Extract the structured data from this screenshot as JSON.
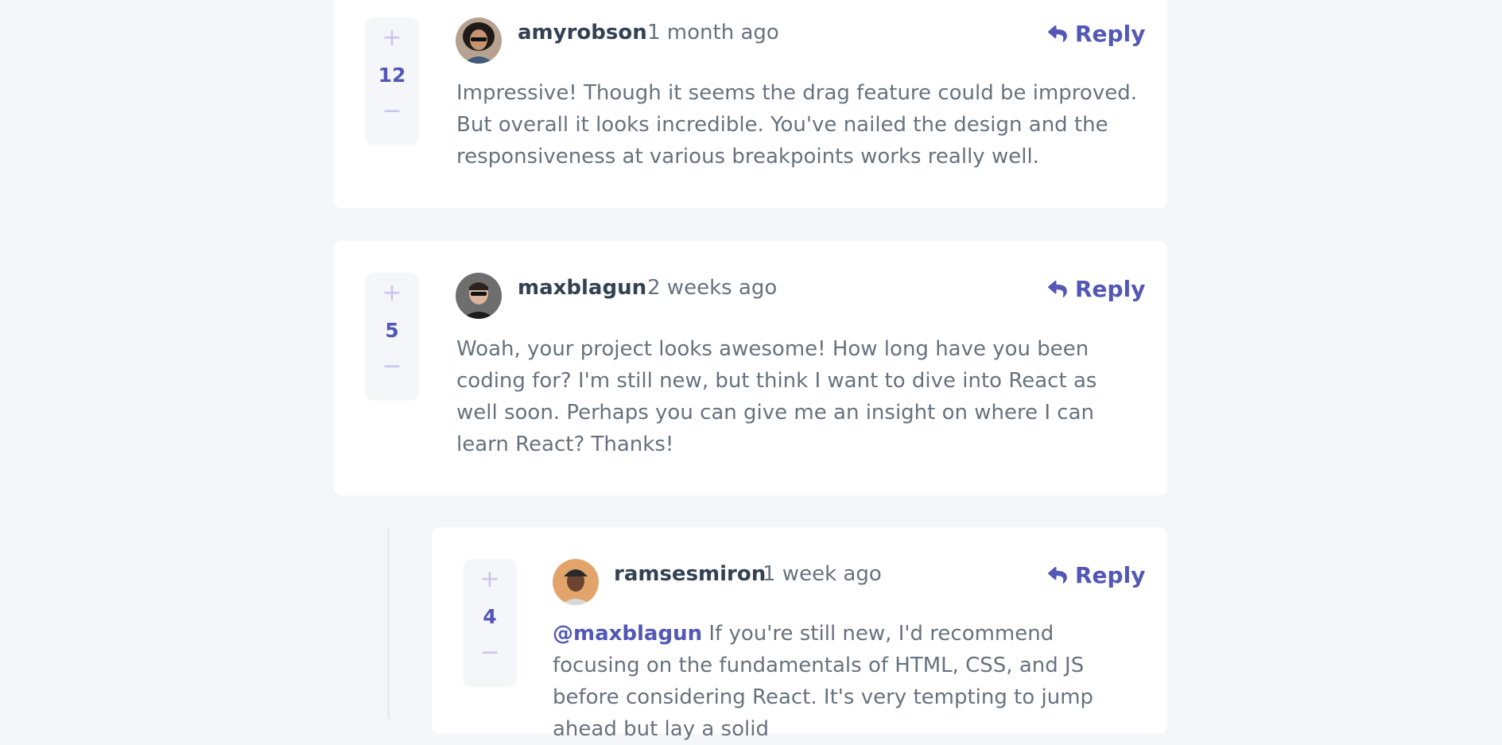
{
  "comments": [
    {
      "username": "amyrobson",
      "time": "1 month ago",
      "score": "12",
      "reply_label": "Reply",
      "content": "Impressive! Though it seems the drag feature could be improved. But overall it looks incredible. You've nailed the design and the responsiveness at various breakpoints works really well."
    },
    {
      "username": "maxblagun",
      "time": "2 weeks ago",
      "score": "5",
      "reply_label": "Reply",
      "content": "Woah, your project looks awesome! How long have you been coding for? I'm still new, but think I want to dive into React as well soon. Perhaps you can give me an insight on where I can learn React? Thanks!"
    },
    {
      "username": "ramsesmiron",
      "time": "1 week ago",
      "score": "4",
      "reply_label": "Reply",
      "replying_to": "@maxblagun",
      "content": "If you're still new, I'd recommend focusing on the fundamentals of HTML, CSS, and JS before considering React. It's very tempting to jump ahead but lay a solid"
    }
  ],
  "icons": {
    "plus": "+",
    "minus": "−",
    "reply": "reply-icon"
  },
  "colors": {
    "accent": "#5357b6",
    "background": "#f5f6fa",
    "vote_icon": "#c5c6ef",
    "text": "#67727e",
    "username": "#334253"
  }
}
